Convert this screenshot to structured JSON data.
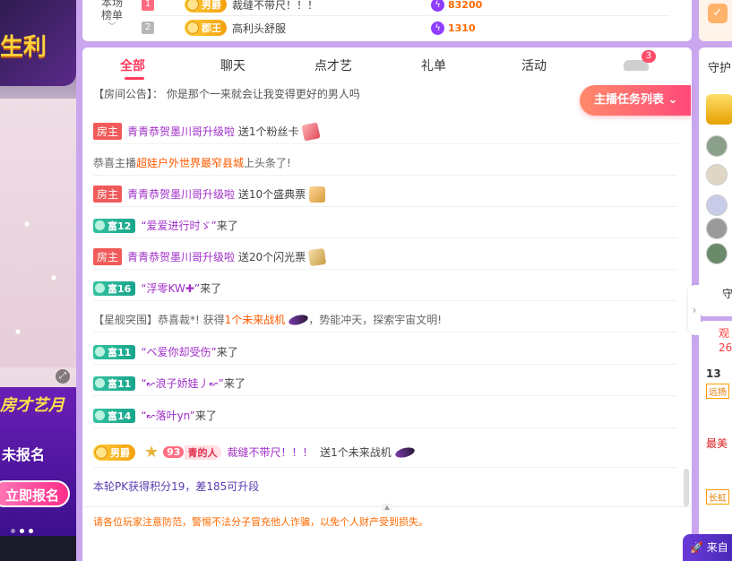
{
  "video": {
    "promo_top_text": "生利",
    "promo_bottom_title": "房才艺月",
    "promo_bottom_subtitle": "未报名",
    "promo_bottom_button": "立即报名"
  },
  "rank_card": {
    "side_label": "本场\n榜单",
    "rows": [
      {
        "num": "1",
        "badge": "男爵",
        "name": "裁缝不带尺！！！",
        "score": "83200"
      },
      {
        "num": "2",
        "badge": "郡王",
        "name": "高利头舒服",
        "score": "1310"
      }
    ]
  },
  "tabs": [
    {
      "label": "全部",
      "active": true
    },
    {
      "label": "聊天"
    },
    {
      "label": "点才艺"
    },
    {
      "label": "礼单"
    },
    {
      "label": "活动"
    }
  ],
  "car_badge": "3",
  "announcement": "【房间公告】： 你是那个一来就会让我变得更好的男人吗",
  "task_button": "主播任务列表",
  "messages": {
    "m1": {
      "tag": "房主",
      "user": "青青恭贺墨川哥升级啦",
      "text": "送1个粉丝卡"
    },
    "m2": {
      "pre": "恭喜主播 ",
      "highlight": "超娃户外世界最窄县城",
      "post": " 上头条了!"
    },
    "m3": {
      "tag": "房主",
      "user": "青青恭贺墨川哥升级啦",
      "text": "送10个盛典票"
    },
    "m4": {
      "level": "富12",
      "user": "“爱爱进行时ゞ”",
      "text": "来了"
    },
    "m5": {
      "tag": "房主",
      "user": "青青恭贺墨川哥升级啦",
      "text": "送20个闪光票"
    },
    "m6": {
      "level": "富16",
      "user": "“浮零KW✚”",
      "text": "来了"
    },
    "m7": {
      "pre": "【星舰突围】恭喜裁*! 获得",
      "highlight": "1个未来战机",
      "post": "，势能冲天，探索宇宙文明!"
    },
    "m8": {
      "level": "富11",
      "user": "“ベ爱你却受伤”",
      "text": "来了"
    },
    "m9": {
      "level": "富11",
      "user": "“↜浪子娇娃丿↜”",
      "text": "来了"
    },
    "m10": {
      "level": "富14",
      "user": "“↜落叶yn”",
      "text": "来了"
    },
    "m11": {
      "badge": "男爵",
      "fan_level": "93",
      "fan_name": "青的人",
      "user": "裁缝不带尺！！！",
      "text": "送1个未来战机"
    }
  },
  "pk_text": "本轮PK获得积分19，差185可升段",
  "warning": "请各位玩家注意防范，警惕不法分子冒充他人诈骗，以免个人财产受到损失。",
  "right": {
    "guard_label": "守护",
    "guard_more": "守",
    "list_head": "观\n26",
    "items": [
      "13",
      "远扬",
      "最美",
      "长虹"
    ],
    "from_text": "来自"
  }
}
